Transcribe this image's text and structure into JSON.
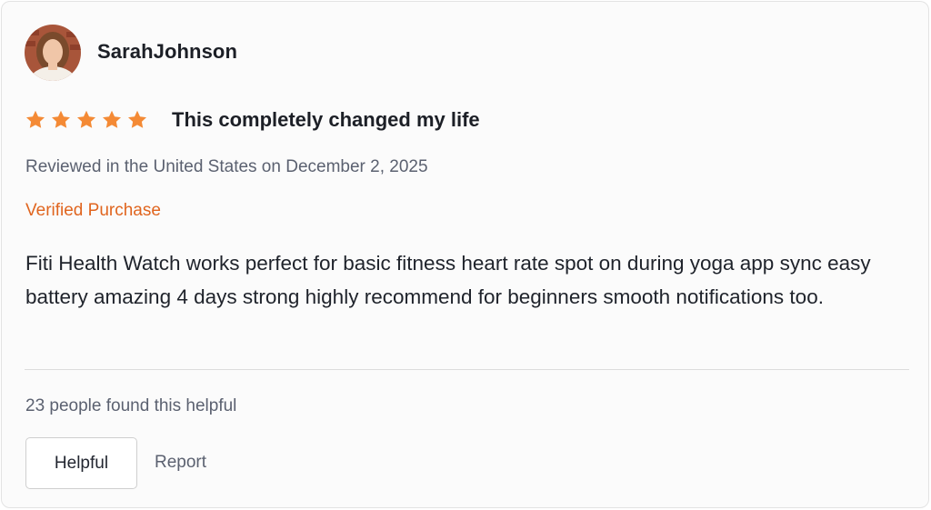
{
  "review": {
    "username": "SarahJohnson",
    "rating": 5,
    "rating_max": 5,
    "star_color": "#f48a35",
    "title": "This completely changed my life",
    "meta": "Reviewed in the United States on December 2, 2025",
    "verified_label": "Verified Purchase",
    "verified_color": "#e0651f",
    "body": "Fiti Health Watch works perfect for basic fitness heart rate spot on during yoga app sync easy battery amazing 4 days strong highly recommend for beginners smooth notifications too.",
    "helpful_count_text": "23 people found this helpful",
    "helpful_button_label": "Helpful",
    "report_label": "Report"
  },
  "icons": {
    "avatar": "user-photo",
    "star": "star-icon"
  }
}
